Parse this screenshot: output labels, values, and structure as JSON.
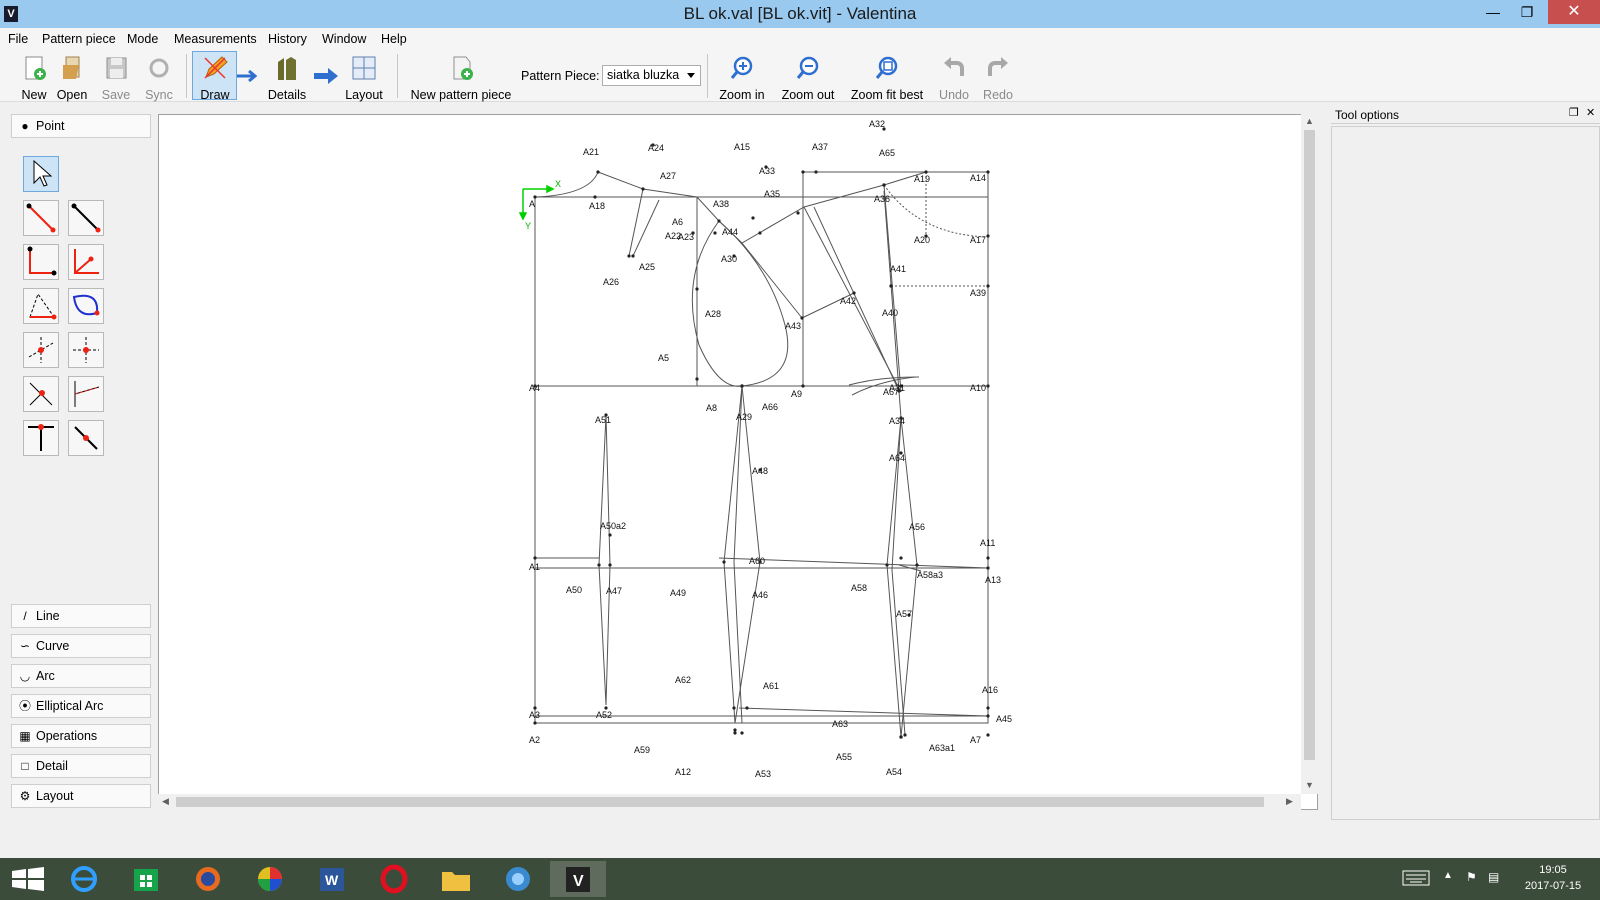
{
  "window": {
    "title": "BL ok.val [BL ok.vit] - Valentina"
  },
  "menu": [
    "File",
    "Pattern piece",
    "Mode",
    "Measurements",
    "History",
    "Window",
    "Help"
  ],
  "toolbar": {
    "new": "New",
    "open": "Open",
    "save": "Save",
    "sync": "Sync",
    "draw": "Draw",
    "details": "Details",
    "layout": "Layout",
    "new_pattern_piece": "New pattern piece",
    "pattern_piece_label": "Pattern Piece:",
    "pattern_piece_value": "siatka bluzka",
    "zoom_in": "Zoom in",
    "zoom_out": "Zoom out",
    "zoom_fit": "Zoom fit best",
    "undo": "Undo",
    "redo": "Redo"
  },
  "left_panel": {
    "point": "Point",
    "categories": [
      "Line",
      "Curve",
      "Arc",
      "Elliptical Arc",
      "Operations",
      "Detail",
      "Layout"
    ]
  },
  "tool_options": {
    "title": "Tool options"
  },
  "drawing": {
    "axis_x": "X",
    "axis_y": "Y",
    "points": [
      {
        "label": "A"
      },
      {
        "label": "A18"
      },
      {
        "label": "A21"
      },
      {
        "label": "A24"
      },
      {
        "label": "A27"
      },
      {
        "label": "A15"
      },
      {
        "label": "A37"
      },
      {
        "label": "A32"
      },
      {
        "label": "A65"
      },
      {
        "label": "A33"
      },
      {
        "label": "A35"
      },
      {
        "label": "A36"
      },
      {
        "label": "A19"
      },
      {
        "label": "A14"
      },
      {
        "label": "A38"
      },
      {
        "label": "A6"
      },
      {
        "label": "A22"
      },
      {
        "label": "A23"
      },
      {
        "label": "A44"
      },
      {
        "label": "A30"
      },
      {
        "label": "A20"
      },
      {
        "label": "A17"
      },
      {
        "label": "A25"
      },
      {
        "label": "A26"
      },
      {
        "label": "A41"
      },
      {
        "label": "A39"
      },
      {
        "label": "A42"
      },
      {
        "label": "A40"
      },
      {
        "label": "A28"
      },
      {
        "label": "A43"
      },
      {
        "label": "A5"
      },
      {
        "label": "A4"
      },
      {
        "label": "A31"
      },
      {
        "label": "A67"
      },
      {
        "label": "A10"
      },
      {
        "label": "A9"
      },
      {
        "label": "A8"
      },
      {
        "label": "A29"
      },
      {
        "label": "A66"
      },
      {
        "label": "A51"
      },
      {
        "label": "A34"
      },
      {
        "label": "A64"
      },
      {
        "label": "A48"
      },
      {
        "label": "A50a2"
      },
      {
        "label": "A56"
      },
      {
        "label": "A11"
      },
      {
        "label": "A1"
      },
      {
        "label": "A60"
      },
      {
        "label": "A58a3"
      },
      {
        "label": "A13"
      },
      {
        "label": "A50"
      },
      {
        "label": "A47"
      },
      {
        "label": "A49"
      },
      {
        "label": "A46"
      },
      {
        "label": "A58"
      },
      {
        "label": "A57"
      },
      {
        "label": "A62"
      },
      {
        "label": "A61"
      },
      {
        "label": "A16"
      },
      {
        "label": "A3"
      },
      {
        "label": "A52"
      },
      {
        "label": "A63"
      },
      {
        "label": "A45"
      },
      {
        "label": "A2"
      },
      {
        "label": "A59"
      },
      {
        "label": "A55"
      },
      {
        "label": "A63a1"
      },
      {
        "label": "A7"
      },
      {
        "label": "A12"
      },
      {
        "label": "A53"
      },
      {
        "label": "A54"
      }
    ]
  },
  "taskbar": {
    "time": "19:05",
    "date": "2017-07-15"
  },
  "colors": {
    "titlebar": "#99c9ef",
    "close": "#c7504e",
    "accent": "#2f6fcf",
    "taskbar": "#3c4c3a"
  }
}
